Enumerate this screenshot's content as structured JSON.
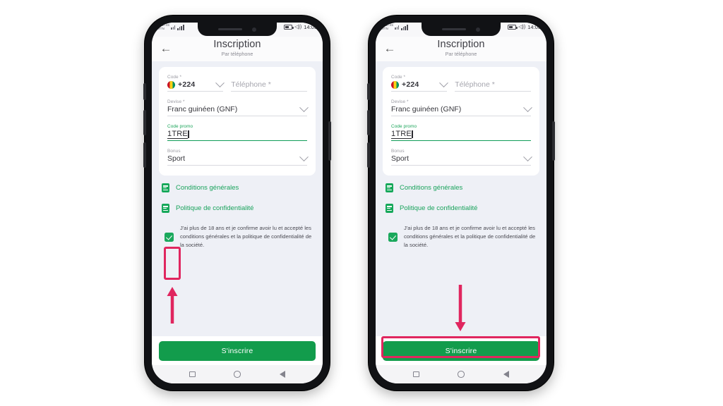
{
  "page": {
    "background": "#ffffff",
    "accent_green": "#129c4c",
    "link_green": "#1aa35c",
    "highlight_pink": "#e0265f"
  },
  "status_bar": {
    "carrier_line1": "CELTIIS",
    "carrier_line2": "MTN",
    "time": "14:03",
    "signal_icon": "signal-bars-icon",
    "battery_icon": "battery-icon",
    "volume_icon": "volume-icon"
  },
  "header": {
    "back_icon": "back-arrow-icon",
    "title": "Inscription",
    "subtitle": "Par téléphone"
  },
  "form": {
    "code": {
      "label": "Code *",
      "flag_icon": "guinea-flag-icon",
      "value": "+224",
      "chevron_icon": "chevron-down-icon"
    },
    "phone": {
      "label": "",
      "placeholder": "Téléphone *",
      "value": ""
    },
    "currency": {
      "label": "Devise *",
      "value": "Franc guinéen (GNF)",
      "chevron_icon": "chevron-down-icon"
    },
    "promo": {
      "label": "Code promo",
      "value": "1TRE"
    },
    "bonus": {
      "label": "Bonus",
      "value": "Sport",
      "chevron_icon": "chevron-down-icon"
    }
  },
  "links": {
    "terms": {
      "icon": "document-icon",
      "label": "Conditions générales"
    },
    "privacy": {
      "icon": "document-icon",
      "label": "Politique de confidentialité"
    }
  },
  "consent": {
    "checkbox_icon": "checkbox-checked-icon",
    "checked": true,
    "text": "J'ai plus de 18 ans et je confirme avoir lu et accepté les conditions générales et la politique de confidentialité de la société."
  },
  "footer": {
    "submit_label": "S'inscrire"
  },
  "navbar": {
    "recents_icon": "square-icon",
    "home_icon": "circle-icon",
    "back_icon": "triangle-back-icon"
  },
  "annotations": {
    "phone1": {
      "highlight_target": "consent-checkbox",
      "arrow_direction": "up"
    },
    "phone2": {
      "highlight_target": "submit-button",
      "arrow_direction": "down"
    }
  }
}
